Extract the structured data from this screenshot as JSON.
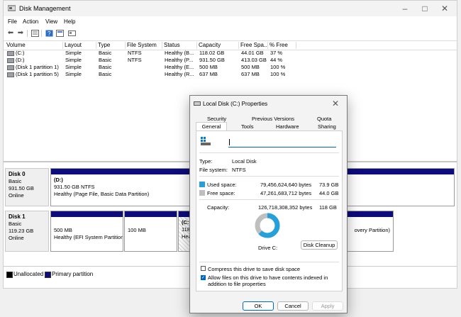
{
  "window": {
    "title": "Disk Management"
  },
  "menu": [
    "File",
    "Action",
    "View",
    "Help"
  ],
  "columns": [
    "Volume",
    "Layout",
    "Type",
    "File System",
    "Status",
    "Capacity",
    "Free Spa...",
    "% Free"
  ],
  "volumes": [
    [
      "(C:)",
      "Simple",
      "Basic",
      "NTFS",
      "Healthy (B...",
      "118.02 GB",
      "44.01 GB",
      "37 %"
    ],
    [
      "(D:)",
      "Simple",
      "Basic",
      "NTFS",
      "Healthy (P...",
      "931.50 GB",
      "413.03 GB",
      "44 %"
    ],
    [
      "(Disk 1 partition 1)",
      "Simple",
      "Basic",
      "",
      "Healthy (E...",
      "500 MB",
      "500 MB",
      "100 %"
    ],
    [
      "(Disk 1 partition 5)",
      "Simple",
      "Basic",
      "",
      "Healthy (R...",
      "637 MB",
      "637 MB",
      "100 %"
    ]
  ],
  "disks": [
    {
      "name": "Disk 0",
      "type": "Basic",
      "size": "931.50 GB",
      "status": "Online",
      "partitions": [
        {
          "title": "(D:)",
          "line1": "931.50 GB NTFS",
          "line2": "Healthy (Page File, Basic Data Partition)"
        }
      ]
    },
    {
      "name": "Disk 1",
      "type": "Basic",
      "size": "119.23 GB",
      "status": "Online",
      "partitions": [
        {
          "title": "",
          "line1": "500 MB",
          "line2": "Healthy (EFI System Partition"
        },
        {
          "title": "",
          "line1": "100 MB",
          "line2": ""
        },
        {
          "title": "(C:",
          "line1": "118.",
          "line2": "Hea"
        },
        {
          "title": "",
          "line1": "",
          "line2": "overy Partition)"
        }
      ]
    }
  ],
  "legend": {
    "unallocated": "Unallocated",
    "primary": "Primary partition",
    "unallocated_color": "#000000",
    "primary_color": "#0c0c7a"
  },
  "dialog": {
    "title": "Local Disk (C:) Properties",
    "tabs_row1": [
      "Security",
      "Previous Versions",
      "Quota"
    ],
    "tabs_row2": [
      "General",
      "Tools",
      "Hardware",
      "Sharing"
    ],
    "name_value": "",
    "type_label": "Type:",
    "type_value": "Local Disk",
    "fs_label": "File system:",
    "fs_value": "NTFS",
    "used_label": "Used space:",
    "used_bytes": "79,456,624,640 bytes",
    "used_gb": "73.9 GB",
    "free_label": "Free space:",
    "free_bytes": "47,261,683,712 bytes",
    "free_gb": "44.0 GB",
    "cap_label": "Capacity:",
    "cap_bytes": "126,718,308,352 bytes",
    "cap_gb": "118 GB",
    "used_fraction": 0.627,
    "used_color": "#26a0da",
    "free_color": "#bfbfbf",
    "drive_label": "Drive C:",
    "cleanup_button": "Disk Cleanup",
    "compress_label": "Compress this drive to save disk space",
    "compress_checked": false,
    "index_label": "Allow files on this drive to have contents indexed in addition to file properties",
    "index_checked": true,
    "ok": "OK",
    "cancel": "Cancel",
    "apply": "Apply"
  }
}
